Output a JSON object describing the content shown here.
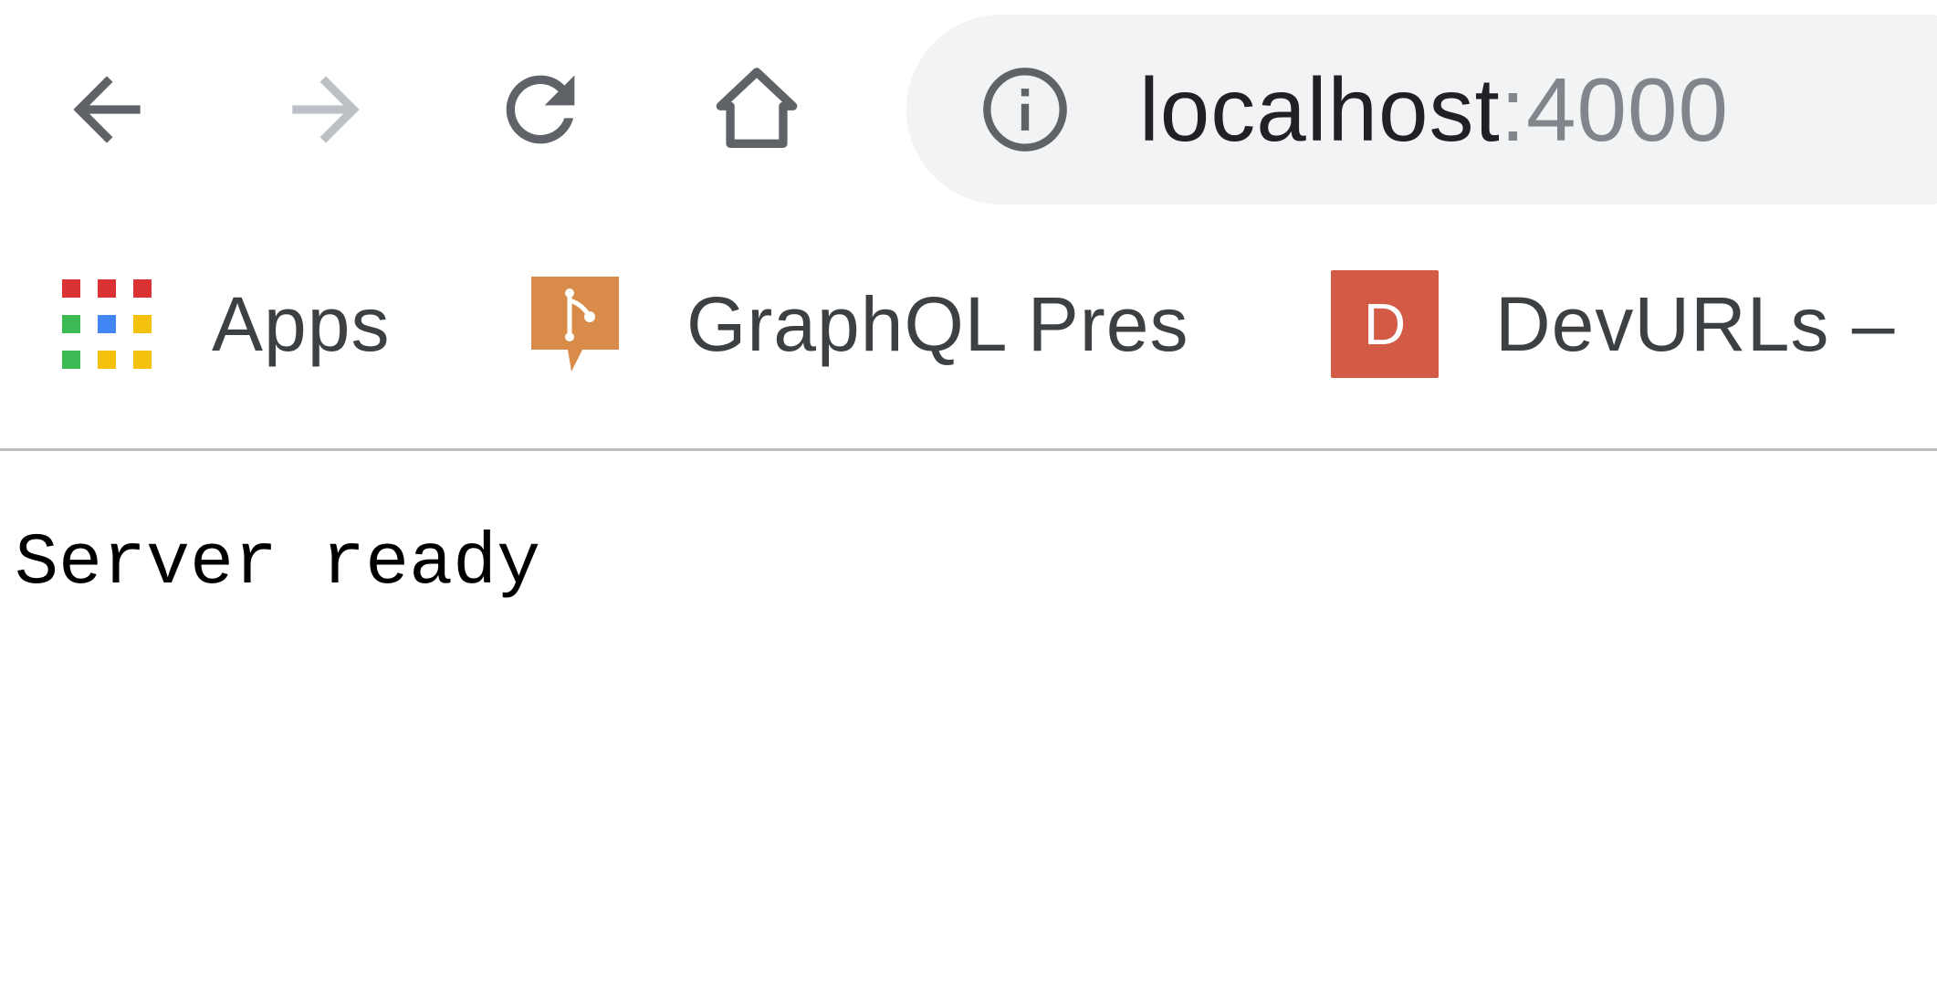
{
  "toolbar": {
    "back_icon": "arrow-left-icon",
    "forward_icon": "arrow-right-icon",
    "reload_icon": "reload-icon",
    "home_icon": "home-icon",
    "omnibox": {
      "info_icon": "info-circle-icon",
      "host": "localhost",
      "port": ":4000"
    },
    "colors": {
      "icon_active": "#5f6368",
      "icon_disabled": "#bdc1c6",
      "omnibox_bg": "#f1f3f4"
    }
  },
  "bookmarks": {
    "items": [
      {
        "label": "Apps",
        "icon": "apps-grid-icon"
      },
      {
        "label": "GraphQL Pres",
        "icon": "graphql-pres-favicon"
      },
      {
        "label": "DevURLs – ",
        "icon": "devurls-favicon",
        "badge": "D",
        "badge_color": "#d35b45"
      }
    ]
  },
  "page": {
    "body_text": "Server ready"
  }
}
